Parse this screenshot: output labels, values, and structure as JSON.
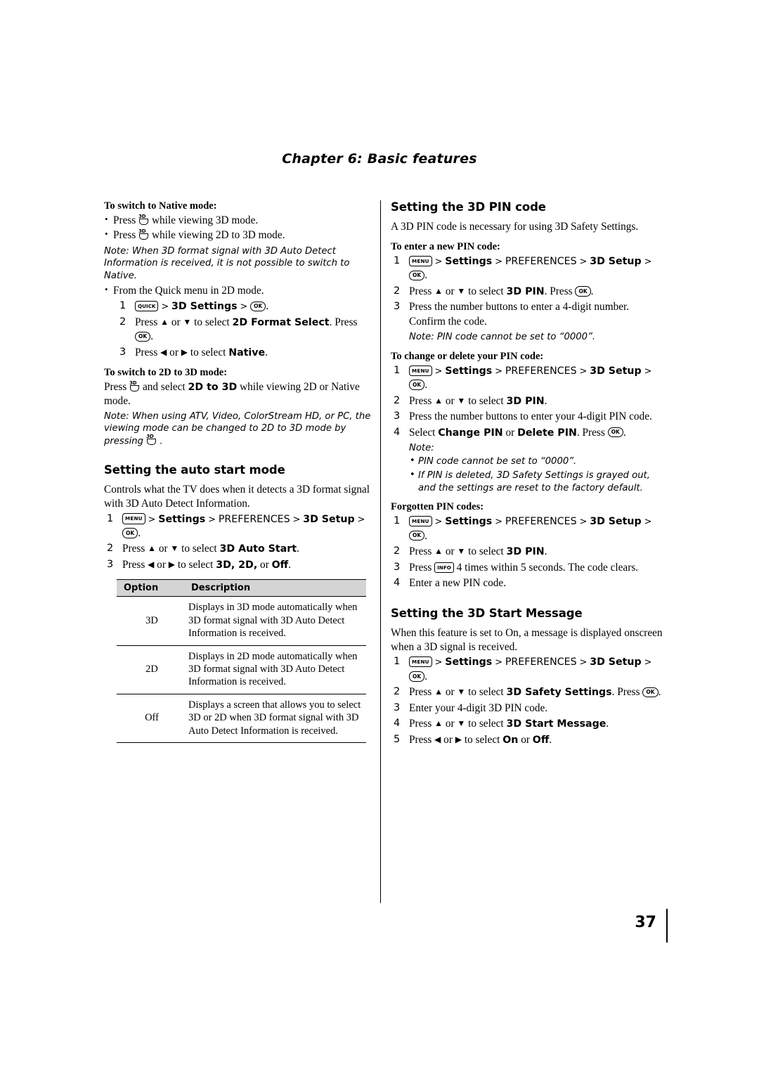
{
  "chapter": "Chapter 6: Basic features",
  "page_number": "37",
  "left": {
    "native_head": "To switch to Native mode:",
    "native_bullets": [
      {
        "pre": "Press",
        "icon": "3d-button-icon",
        "post": "while viewing 3D mode."
      },
      {
        "pre": "Press",
        "icon": "3d-button-icon",
        "post": "while viewing 2D to 3D mode."
      }
    ],
    "native_note": "Note: When 3D format signal with 3D Auto Detect Information is received, it is not possible to switch to Native.",
    "quick_bullet": "From the Quick menu in 2D mode.",
    "quick_steps": [
      {
        "num": "1",
        "parts": [
          "QUICK",
          ">",
          "3D Settings",
          ">",
          "OK",
          "."
        ]
      },
      {
        "num": "2",
        "text_a": "Press ",
        "text_b": " or ",
        "text_c": " to select ",
        "bold": "2D Format Select",
        "text_d": ". Press ",
        "key": "OK",
        "text_e": "."
      },
      {
        "num": "3",
        "text_a": "Press ",
        "text_b": " or ",
        "text_c": " to select ",
        "bold": "Native",
        "text_d": "."
      }
    ],
    "twod_head": "To switch to 2D to 3D mode:",
    "twod_text_pre": "Press",
    "twod_text_mid": "and select",
    "twod_bold": "2D to 3D",
    "twod_text_post": "while viewing 2D or Native mode.",
    "twod_note": "Note: When using ATV, Video, ColorStream HD, or PC, the viewing mode can be changed to 2D to 3D mode by pressing",
    "autostart_title": "Setting the auto start mode",
    "autostart_intro": "Controls what the TV does when it detects a 3D format signal with 3D Auto Detect Information.",
    "autostart_steps": [
      {
        "num": "1",
        "path": [
          "MENU",
          ">",
          "Settings",
          ">",
          "PREFERENCES",
          ">",
          "3D Setup",
          ">",
          "OK"
        ]
      },
      {
        "num": "2",
        "text_a": "Press ",
        "text_b": " or ",
        "text_c": " to select ",
        "bold": "3D Auto Start",
        "text_d": "."
      },
      {
        "num": "3",
        "text_a": "Press ",
        "text_b": " or ",
        "text_c": " to select ",
        "bold": "3D, 2D,",
        "text_d": " or ",
        "bold2": "Off",
        "text_e": "."
      }
    ],
    "table": {
      "headers": [
        "Option",
        "Description"
      ],
      "rows": [
        {
          "option": "3D",
          "description": "Displays in 3D mode automatically when 3D format signal with 3D Auto Detect Information is received."
        },
        {
          "option": "2D",
          "description": "Displays in 2D mode automatically when 3D format signal with 3D Auto Detect Information is received."
        },
        {
          "option": "Off",
          "description": "Displays a screen that allows you to select 3D or 2D when 3D format signal with 3D Auto Detect Information is received."
        }
      ]
    }
  },
  "right": {
    "pin_title": "Setting the 3D PIN code",
    "pin_intro": "A 3D PIN code is necessary for using 3D Safety Settings.",
    "enter_head": "To enter a new PIN code:",
    "enter_steps": [
      {
        "num": "1",
        "path": [
          "MENU",
          ">",
          "Settings",
          ">",
          "PREFERENCES",
          ">",
          "3D Setup",
          ">",
          "OK"
        ]
      },
      {
        "num": "2",
        "text_a": "Press ",
        "text_b": " or ",
        "text_c": " to select ",
        "bold": "3D PIN",
        "text_d": ". Press ",
        "key": "OK",
        "text_e": "."
      },
      {
        "num": "3",
        "plain": "Press the number buttons to enter a 4-digit number. Confirm the code."
      }
    ],
    "enter_note": "Note: PIN code cannot be set to “0000”.",
    "change_head": "To change or delete your PIN code:",
    "change_steps": [
      {
        "num": "1",
        "path": [
          "MENU",
          ">",
          "Settings",
          ">",
          "PREFERENCES",
          ">",
          "3D Setup",
          ">",
          "OK"
        ]
      },
      {
        "num": "2",
        "text_a": "Press ",
        "text_b": " or ",
        "text_c": " to select ",
        "bold": "3D PIN",
        "text_d": "."
      },
      {
        "num": "3",
        "plain": "Press the number buttons to enter your 4-digit PIN code."
      },
      {
        "num": "4",
        "text_a": "Select ",
        "bold": "Change PIN",
        "text_b": " or ",
        "bold2": "Delete PIN",
        "text_c": ". Press ",
        "key": "OK",
        "text_d": "."
      }
    ],
    "note_label": "Note:",
    "change_notes": [
      "PIN code cannot be set to “0000”.",
      "If PIN is deleted, 3D Safety Settings is grayed out, and the settings are reset to the factory default."
    ],
    "forgotten_head": "Forgotten PIN codes:",
    "forgotten_steps": [
      {
        "num": "1",
        "path": [
          "MENU",
          ">",
          "Settings",
          ">",
          "PREFERENCES",
          ">",
          "3D Setup",
          ">",
          "OK"
        ]
      },
      {
        "num": "2",
        "text_a": "Press ",
        "text_b": " or ",
        "text_c": " to select ",
        "bold": "3D PIN",
        "text_d": "."
      },
      {
        "num": "3",
        "text_a": "Press ",
        "key": "INFO",
        "text_b": " 4 times within 5 seconds. The code clears."
      },
      {
        "num": "4",
        "plain": "Enter a new PIN code."
      }
    ],
    "startmsg_title": "Setting the 3D Start Message",
    "startmsg_intro": "When this feature is set to On, a message is displayed onscreen when a 3D signal is received.",
    "startmsg_steps": [
      {
        "num": "1",
        "path": [
          "MENU",
          ">",
          "Settings",
          ">",
          "PREFERENCES",
          ">",
          "3D Setup",
          ">",
          "OK"
        ]
      },
      {
        "num": "2",
        "text_a": "Press ",
        "text_b": " or ",
        "text_c": " to select ",
        "bold": "3D Safety Settings",
        "text_d": ". Press ",
        "key": "OK",
        "text_e": "."
      },
      {
        "num": "3",
        "plain": "Enter your 4-digit 3D PIN code."
      },
      {
        "num": "4",
        "text_a": "Press ",
        "text_b": " or ",
        "text_c": " to select ",
        "bold": "3D Start Message",
        "text_d": "."
      },
      {
        "num": "5",
        "text_a": "Press ",
        "text_b": " or ",
        "text_c": " to select ",
        "bold": "On",
        "text_d": " or ",
        "bold2": "Off",
        "text_e": "."
      }
    ]
  },
  "keys": {
    "menu": "MENU",
    "ok": "OK",
    "quick": "QUICK",
    "info": "INFO",
    "gt": ">",
    "up": "▲",
    "down": "▼",
    "left": "◀",
    "right": "▶"
  }
}
